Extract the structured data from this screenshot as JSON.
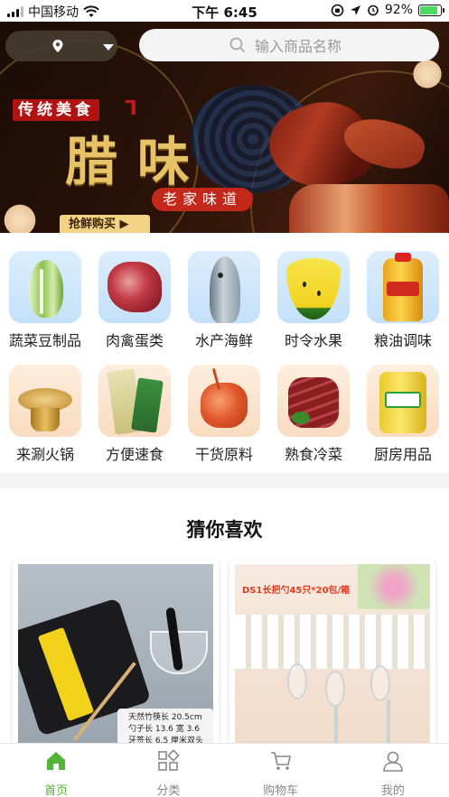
{
  "status_bar": {
    "carrier": "中国移动",
    "time": "下午 6:45",
    "battery": "92%",
    "battery_level": 0.92
  },
  "header": {
    "search_placeholder": "输入商品名称"
  },
  "banner": {
    "tag": "传统美食",
    "title": "腊味",
    "subtitle": "老家味道",
    "cta": "抢鲜购买 ▶"
  },
  "categories": [
    {
      "label": "蔬菜豆制品",
      "icon": "cabbage"
    },
    {
      "label": "肉禽蛋类",
      "icon": "raw-meat"
    },
    {
      "label": "水产海鲜",
      "icon": "fish"
    },
    {
      "label": "时令水果",
      "icon": "watermelon"
    },
    {
      "label": "粮油调味",
      "icon": "oil-bottle"
    },
    {
      "label": "来涮火锅",
      "icon": "hotpot"
    },
    {
      "label": "方便速食",
      "icon": "instant-food"
    },
    {
      "label": "干货原料",
      "icon": "dried-shrimp"
    },
    {
      "label": "熟食冷菜",
      "icon": "sliced-beef"
    },
    {
      "label": "厨房用品",
      "icon": "detergent"
    }
  ],
  "guess": {
    "title": "猜你喜欢",
    "products": [
      {
        "image": "disposable-tableware-set",
        "caption_lines": [
          "天然竹筷长 20.5cm",
          "勺子长 13.6 宽 3.6",
          "牙签长 6.5 厘米双头"
        ]
      },
      {
        "image": "plastic-spoons",
        "caption_lines": [
          "DS1长把勺45只*20包/箱"
        ]
      }
    ]
  },
  "tabbar": {
    "active_color": "#55b33a",
    "items": [
      {
        "label": "首页",
        "icon": "home-icon",
        "active": true
      },
      {
        "label": "分类",
        "icon": "category-icon",
        "active": false
      },
      {
        "label": "购物车",
        "icon": "cart-icon",
        "active": false
      },
      {
        "label": "我的",
        "icon": "user-icon",
        "active": false
      }
    ]
  }
}
